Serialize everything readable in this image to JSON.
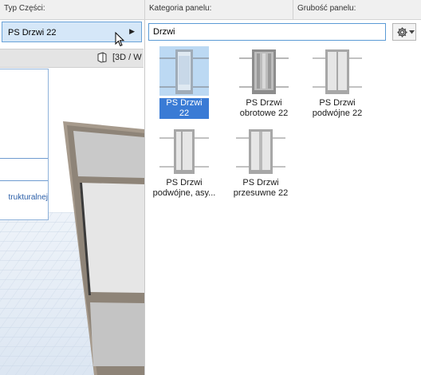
{
  "header": {
    "col1": "Typ Części:",
    "col2": "Kategoria panelu:",
    "col3": "Grubość panelu:"
  },
  "type_selector": {
    "value": "PS Drzwi 22"
  },
  "view": {
    "label": "[3D / W"
  },
  "info": {
    "text": "trukturalnej"
  },
  "search": {
    "value": "Drzwi"
  },
  "items": [
    {
      "line1": "PS Drzwi 22",
      "line2": "",
      "selected": true,
      "icon": "door-single-icon"
    },
    {
      "line1": "PS Drzwi",
      "line2": "obrotowe 22",
      "selected": false,
      "icon": "door-revolving-icon"
    },
    {
      "line1": "PS Drzwi",
      "line2": "podwójne 22",
      "selected": false,
      "icon": "door-double-icon"
    },
    {
      "line1": "PS Drzwi",
      "line2": "podwójne, asy...",
      "selected": false,
      "icon": "door-double-asym-icon"
    },
    {
      "line1": "PS Drzwi",
      "line2": "przesuwne 22",
      "selected": false,
      "icon": "door-sliding-icon"
    }
  ],
  "colors": {
    "selection": "#3a7bd5",
    "accent_border": "#5b9bd5"
  }
}
